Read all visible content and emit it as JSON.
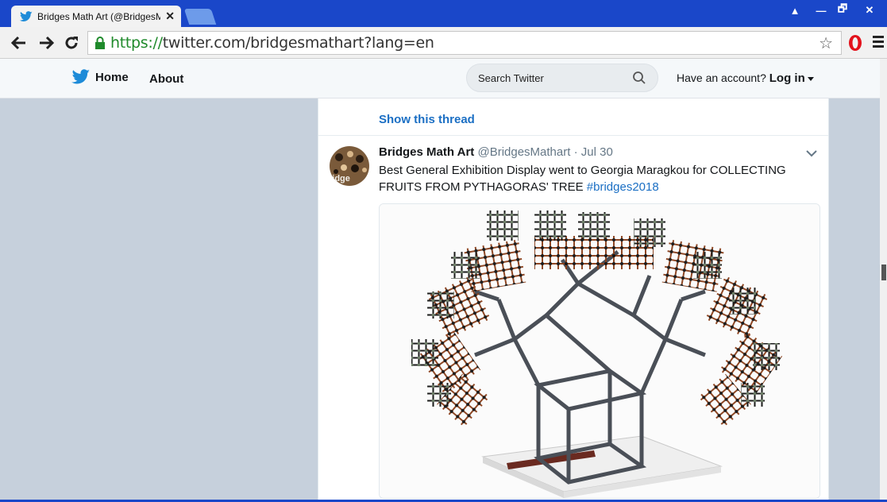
{
  "browser": {
    "tab_title": "Bridges Math Art (@BridgesM",
    "tab_close": "✕",
    "url_secure": "https://",
    "url_rest": "twitter.com/bridgesmathart?lang=en",
    "window_controls": [
      "▲",
      "—",
      "🗗",
      "✕"
    ],
    "bookmark_icon": "☆"
  },
  "nav": {
    "home_label": "Home",
    "about_label": "About",
    "search_placeholder": "Search Twitter",
    "account_prompt": "Have an account?",
    "login_label": "Log in"
  },
  "timeline": {
    "show_thread": "Show this thread",
    "tweet": {
      "name": "Bridges Math Art",
      "handle": "@BridgesMathart",
      "separator": " · ",
      "date": "Jul 30",
      "text": "Best General Exhibition Display went to Georgia Maragkou for COLLECTING FRUITS FROM PYTHAGORAS' TREE ",
      "hashtag": "#bridges2018",
      "avatar_text": "ridge"
    }
  },
  "colors": {
    "titlebar": "#1a47c9",
    "link": "#1b6fc4",
    "twitter_blue": "#1d8bd8",
    "secure_green": "#1f8a2b"
  }
}
